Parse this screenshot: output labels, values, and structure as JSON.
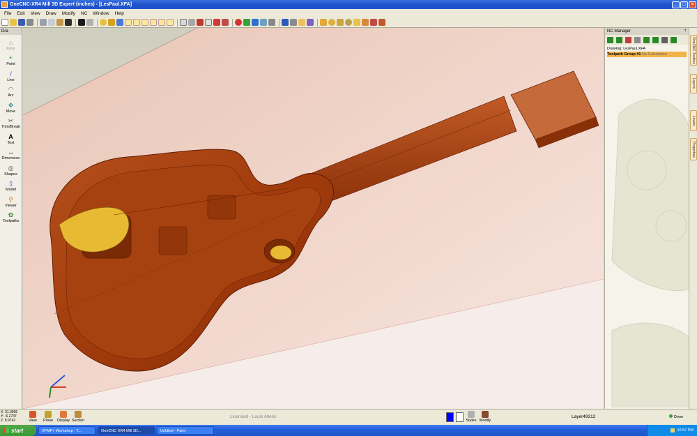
{
  "window": {
    "title": "OneCNC-XR4 Mill 3D Expert (inches) - [LesPaul.XFA]",
    "minimize": "_",
    "maximize": "□",
    "close": "×"
  },
  "menu": [
    "File",
    "Edit",
    "View",
    "Draw",
    "Modify",
    "NC",
    "Window",
    "Help"
  ],
  "palette": {
    "header": "Dra",
    "items": [
      {
        "label": "Keys",
        "icon": "house-icon",
        "glyph": "⌂",
        "disabled": true
      },
      {
        "label": "Point",
        "icon": "point-icon",
        "glyph": "+"
      },
      {
        "label": "Line",
        "icon": "line-icon",
        "glyph": "/"
      },
      {
        "label": "Arc",
        "icon": "arc-icon",
        "glyph": "◠"
      },
      {
        "label": "Move",
        "icon": "move-icon",
        "glyph": "✥"
      },
      {
        "label": "Trim/Break",
        "icon": "trim-icon",
        "glyph": "✂"
      },
      {
        "label": "Text",
        "icon": "text-icon",
        "glyph": "A"
      },
      {
        "label": "Dimension",
        "icon": "dimension-icon",
        "glyph": "↔"
      },
      {
        "label": "Shapes",
        "icon": "shapes-icon",
        "glyph": "◎"
      },
      {
        "label": "Model",
        "icon": "model-icon",
        "glyph": "▯"
      },
      {
        "label": "Viewer",
        "icon": "viewer-icon",
        "glyph": "⚲"
      },
      {
        "label": "Toolpaths",
        "icon": "toolpaths-icon",
        "glyph": "✿"
      }
    ]
  },
  "nc_manager": {
    "title": "NC Manager",
    "pin": "ᛘ",
    "tree": {
      "drawing": "Drawing: LesPaul.XFA",
      "group": "Toolpath Group #1",
      "group_note": "No Calculation"
    }
  },
  "side_tabs": [
    "OneCNC Toolbox",
    "Layers",
    "Levels",
    "Properties"
  ],
  "status": {
    "coords": [
      "X: 31.3995",
      "Y: -6.2737",
      "Z: 8.9742"
    ],
    "view_buttons": [
      "View",
      "Plane",
      "Display",
      "Section"
    ],
    "license": "Licensed - Louis Alleris",
    "style_label": "Styles",
    "modify_label": "Modify",
    "layer": "Layer49312",
    "state": "Done"
  },
  "colors": {
    "body": "#a9400f",
    "body_dark": "#6e2206",
    "pickguard": "#e8ba34",
    "plane": "#f0d4c6",
    "bg_top": "#cfcfc0",
    "swatch_1": "#0000ff",
    "swatch_2": "#ffffff"
  },
  "taskbar": {
    "start": "start",
    "tasks": [
      "XFMP+ Workshop - T...",
      "OneCNC XR4 Mill 3D...",
      "Untitled - Paint"
    ],
    "clock": "10:57 PM"
  }
}
